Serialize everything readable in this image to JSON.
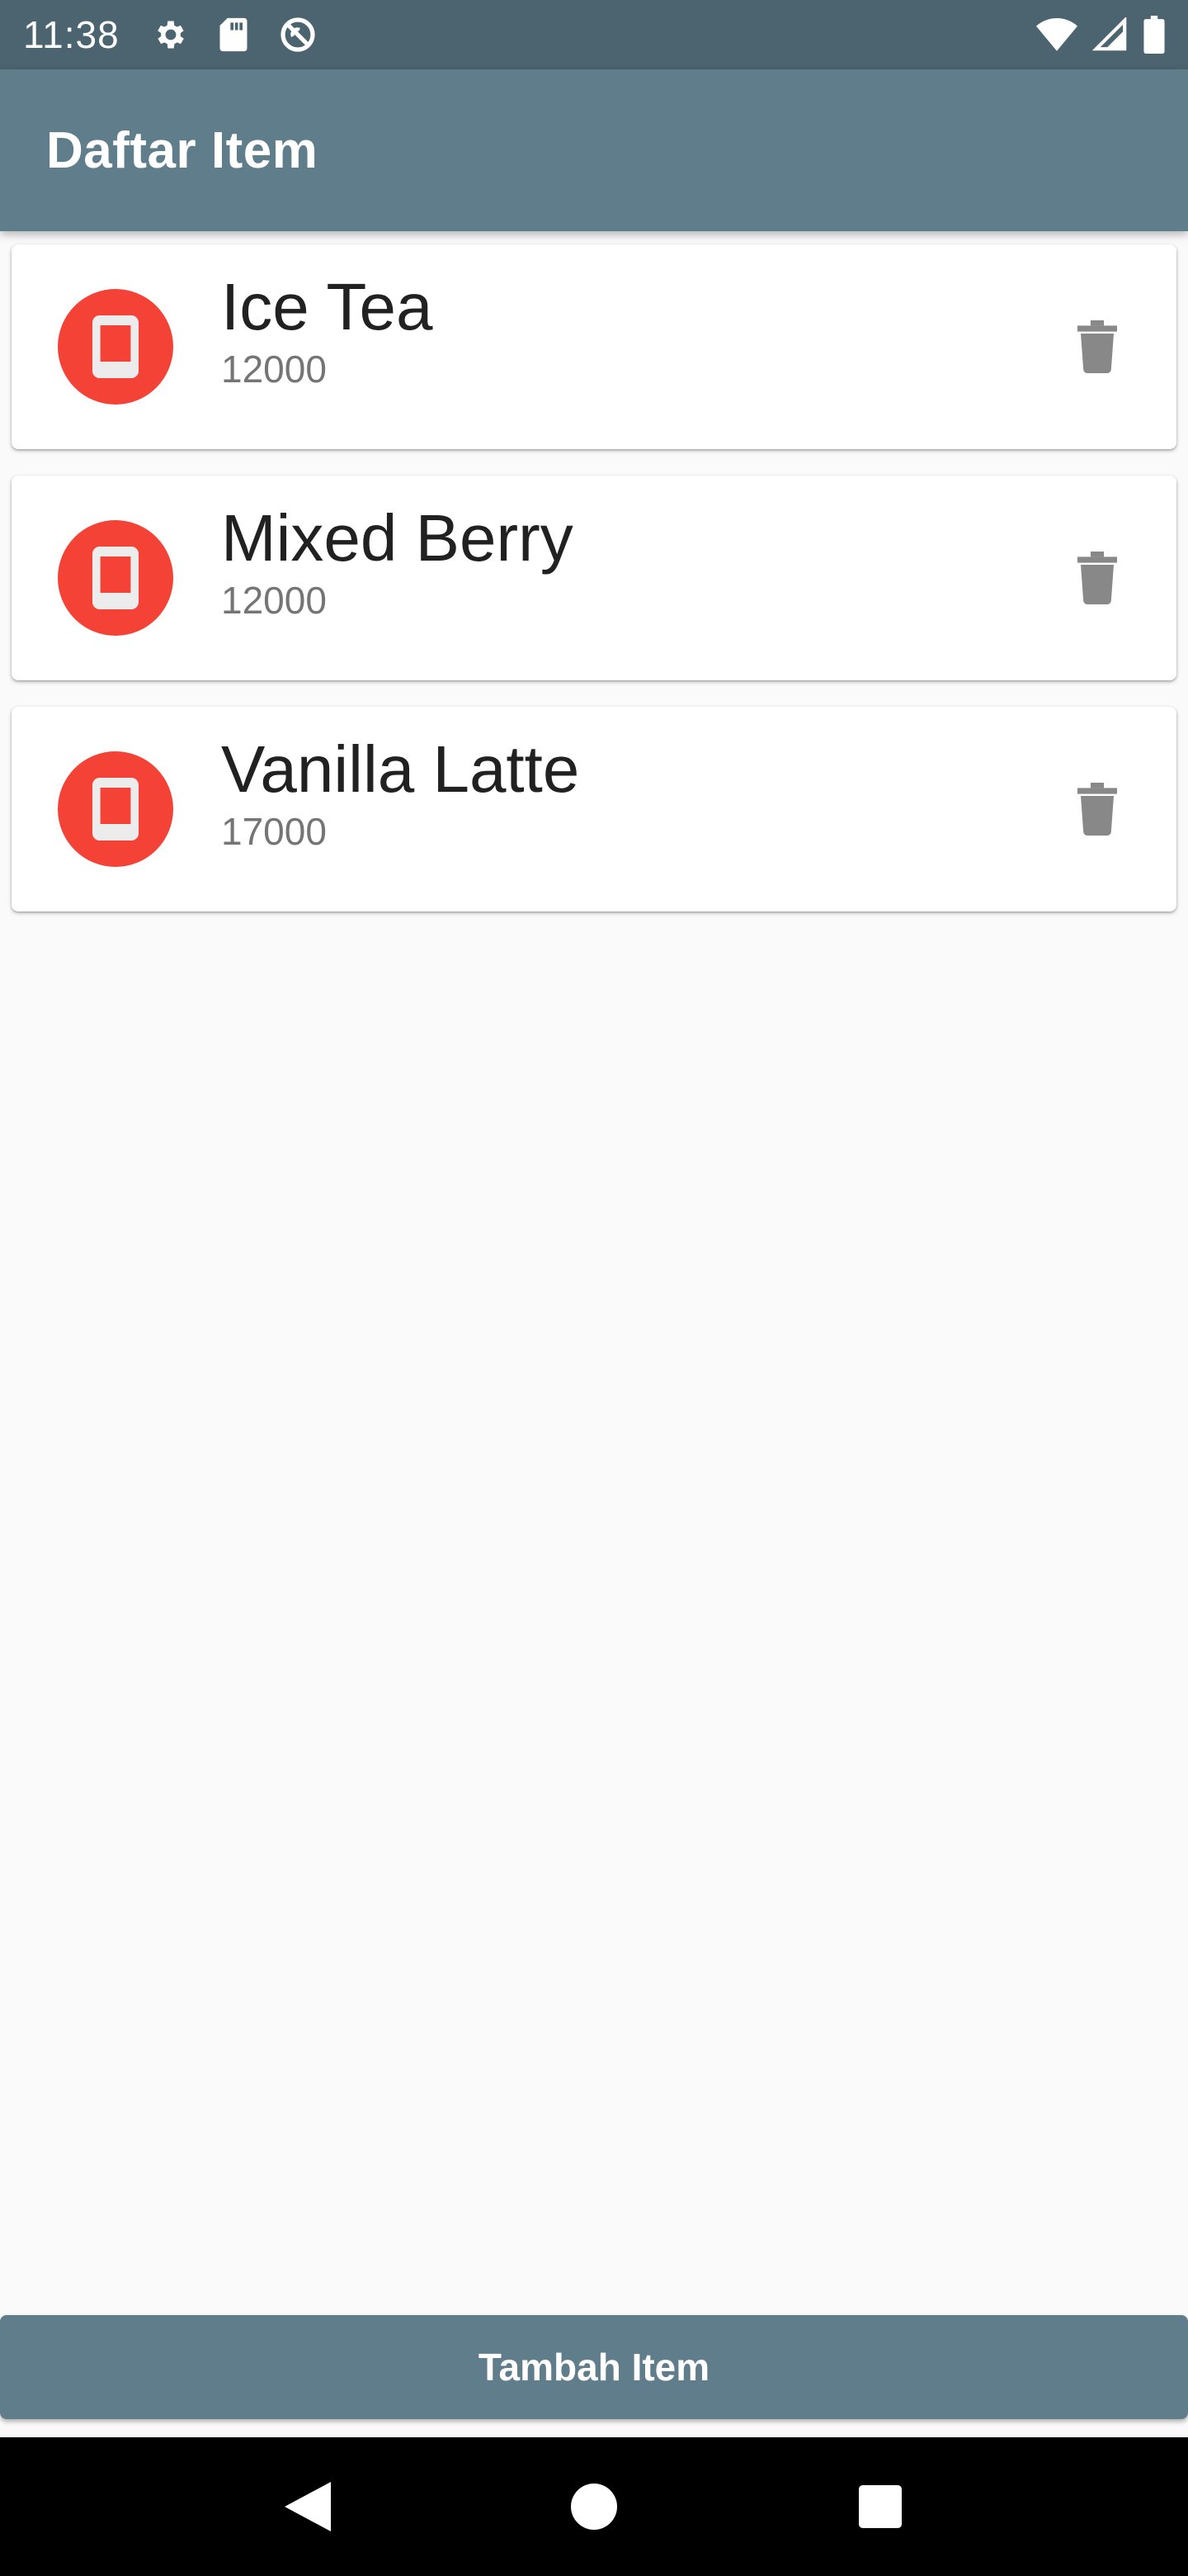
{
  "status_bar": {
    "time": "11:38",
    "left_icons": [
      "gear-icon",
      "sd-card-icon",
      "do-not-disturb-icon"
    ],
    "right_icons": [
      "wifi-icon",
      "cell-signal-icon",
      "battery-icon"
    ]
  },
  "app_bar": {
    "title": "Daftar Item",
    "color": "#607d8b"
  },
  "items": [
    {
      "name": "Ice Tea",
      "price": "12000",
      "icon": "phone-icon",
      "icon_color": "#f44336",
      "action_icon": "trash-icon"
    },
    {
      "name": "Mixed Berry",
      "price": "12000",
      "icon": "phone-icon",
      "icon_color": "#f44336",
      "action_icon": "trash-icon"
    },
    {
      "name": "Vanilla Latte",
      "price": "17000",
      "icon": "phone-icon",
      "icon_color": "#f44336",
      "action_icon": "trash-icon"
    }
  ],
  "bottom_button": {
    "label": "Tambah Item",
    "color": "#607d8b"
  },
  "nav_bar": {
    "buttons": [
      "back-icon",
      "home-icon",
      "recents-icon"
    ]
  }
}
